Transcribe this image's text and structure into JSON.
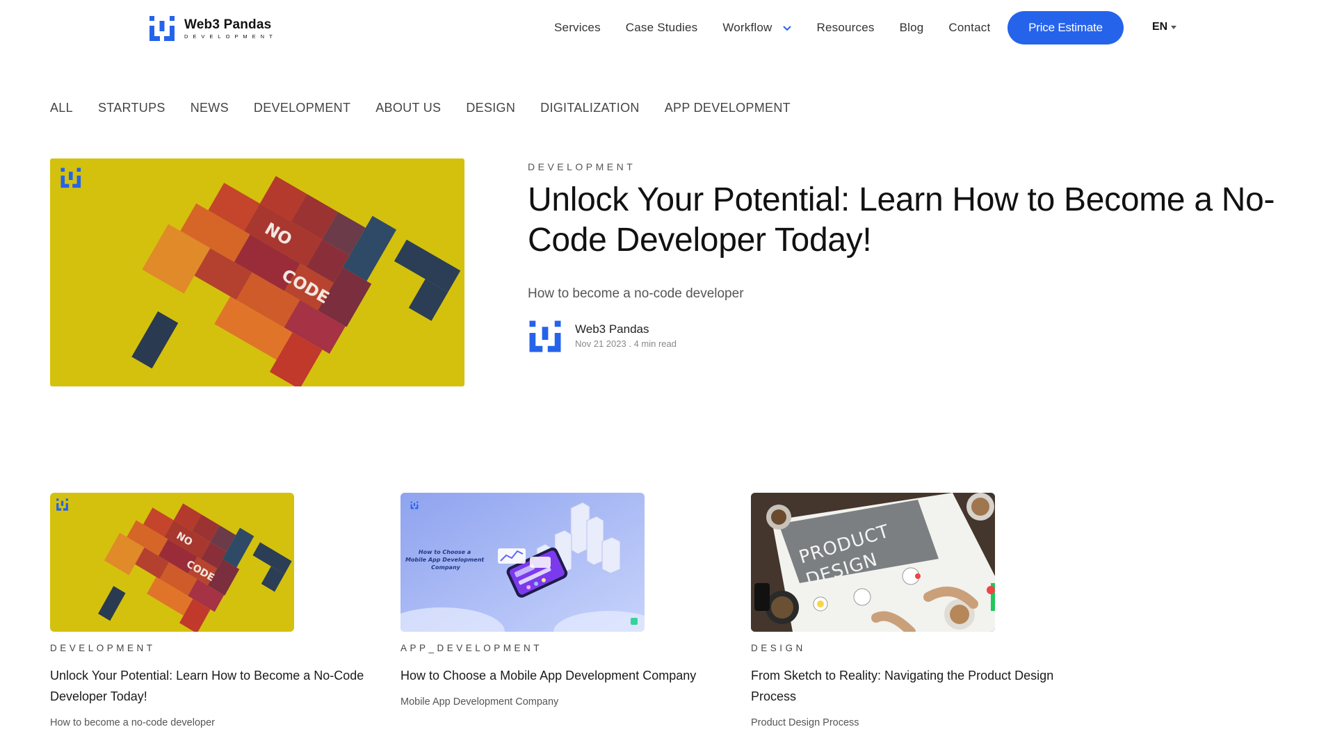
{
  "brand": {
    "name": "Web3 Pandas",
    "tagline": "DEVELOPMENT",
    "color": "#2563eb"
  },
  "nav": {
    "items": [
      "Services",
      "Case Studies",
      "Workflow",
      "Resources",
      "Blog",
      "Contact"
    ],
    "cta": "Price Estimate",
    "language": "EN"
  },
  "categories": [
    "ALL",
    "STARTUPS",
    "NEWS",
    "DEVELOPMENT",
    "ABOUT US",
    "DESIGN",
    "DIGITALIZATION",
    "APP DEVELOPMENT"
  ],
  "featured": {
    "category": "DEVELOPMENT",
    "title": "Unlock Your Potential: Learn How to Become a No-Code Developer Today!",
    "subtitle": "How to become a no-code developer",
    "image_text": [
      "NO",
      "CODE"
    ],
    "author": {
      "name": "Web3 Pandas",
      "date": "Nov 21 2023",
      "read_time": "4 min read"
    }
  },
  "cards": [
    {
      "category": "DEVELOPMENT",
      "title": "Unlock Your Potential: Learn How to Become a No-Code Developer Today!",
      "subtitle": "How to become a no-code developer",
      "image_text": [
        "NO",
        "CODE"
      ]
    },
    {
      "category": "APP_DEVELOPMENT",
      "title": "How to Choose a Mobile App Development Company",
      "subtitle": "Mobile App Development Company",
      "image_text": "How to Choose a Mobile App Development Company"
    },
    {
      "category": "DESIGN",
      "title": "From Sketch to Reality: Navigating the Product Design Process",
      "subtitle": "Product Design Process",
      "image_text": [
        "PRODUCT",
        "DESIGN"
      ]
    }
  ]
}
